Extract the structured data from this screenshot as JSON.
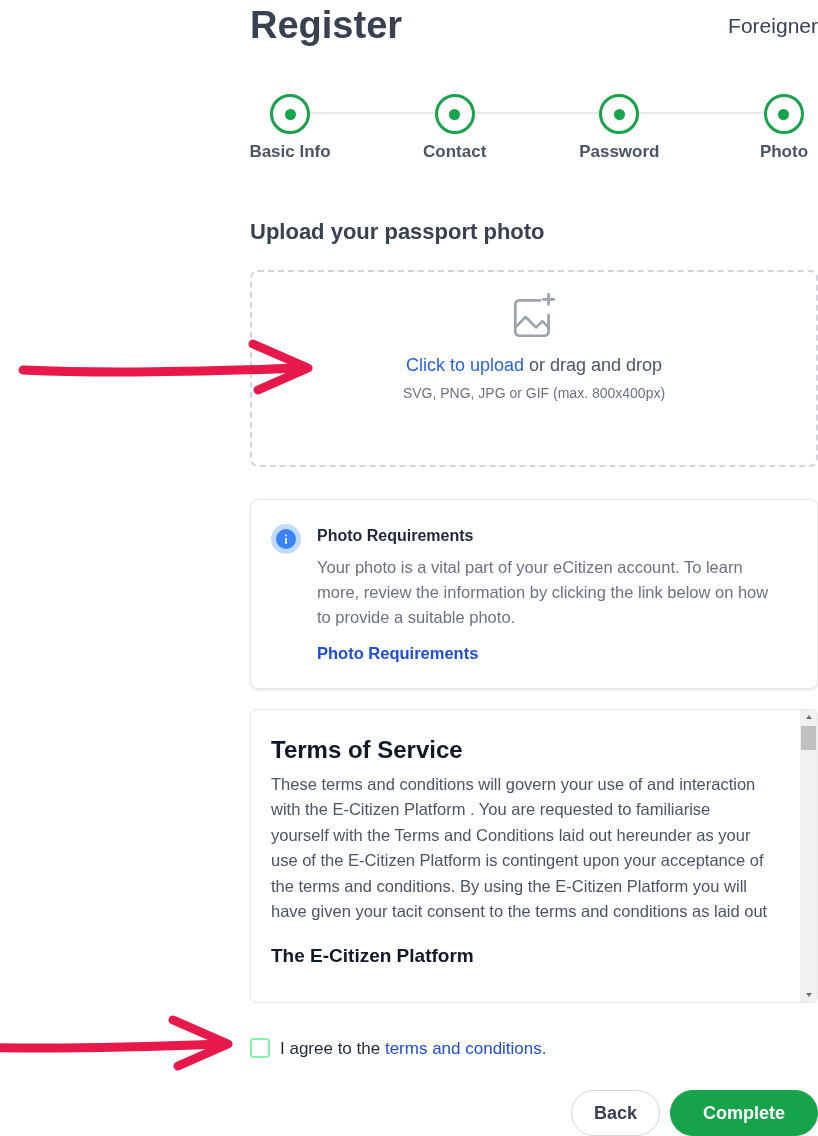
{
  "header": {
    "title": "Register",
    "account_type": "Foreigner"
  },
  "steps": [
    {
      "label": "Basic Info",
      "done": true
    },
    {
      "label": "Contact",
      "done": true
    },
    {
      "label": "Password",
      "done": true
    },
    {
      "label": "Photo",
      "done": true
    }
  ],
  "upload": {
    "heading": "Upload your passport photo",
    "link": "Click to upload",
    "text": "or drag and drop",
    "hint": "SVG, PNG, JPG or GIF (max. 800x400px)"
  },
  "info": {
    "title": "Photo Requirements",
    "body": "Your photo is a vital part of your eCitizen account. To learn more, review the information by clicking the link below on how to provide a suitable photo.",
    "link": "Photo Requirements"
  },
  "terms": {
    "title": "Terms of Service",
    "body": "These terms and conditions will govern your use of and interaction with the E-Citizen Platform . You are requested to familiarise yourself with the Terms and Conditions  laid out hereunder as your use of the E-Citizen Platform is contingent upon your acceptance of the terms and conditions. By using the E-Citizen Platform you will have given your tacit consent to the terms and conditions as laid out",
    "subheading": "The E-Citizen Platform"
  },
  "agree": {
    "checked": false,
    "text": "I agree to the",
    "link": "terms and conditions."
  },
  "buttons": [
    {
      "label": "Back",
      "kind": "secondary"
    },
    {
      "label": "Complete",
      "kind": "primary"
    }
  ]
}
